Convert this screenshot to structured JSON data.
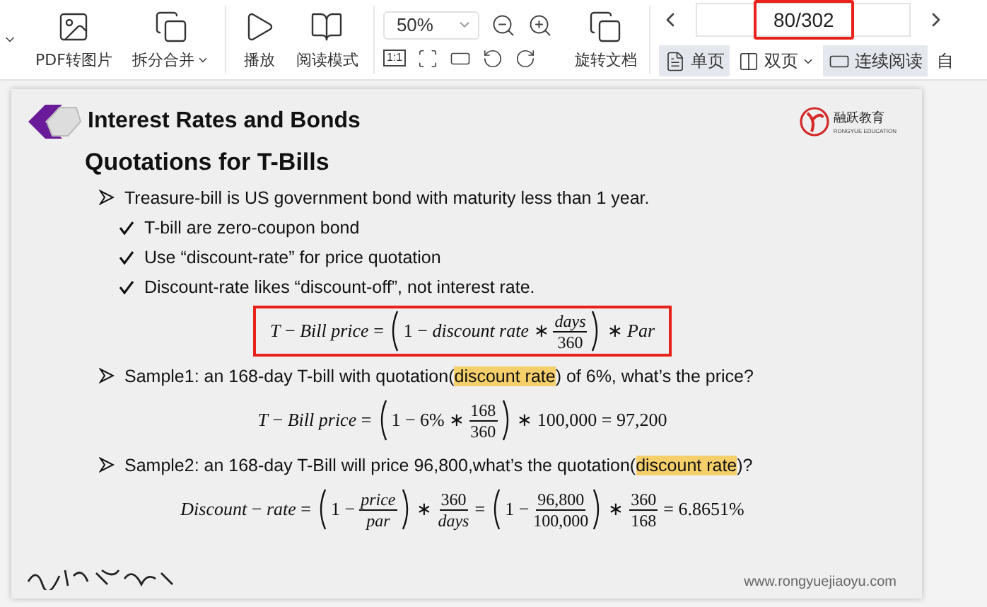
{
  "toolbar": {
    "tools": [
      {
        "kind": "to-image",
        "label": "PDF转图片",
        "has_menu": false
      },
      {
        "kind": "split-merge",
        "label": "拆分合并",
        "has_menu": true
      },
      {
        "kind": "play",
        "label": "播放",
        "has_menu": false
      },
      {
        "kind": "reading",
        "label": "阅读模式",
        "has_menu": false
      }
    ],
    "zoom": {
      "value": "50%",
      "actual_size": "1:1"
    },
    "rotate": {
      "label": "旋转文档"
    },
    "page": {
      "value": "80/302",
      "highlighted": true
    },
    "view_modes": [
      {
        "kind": "single",
        "label": "单页",
        "selected": true,
        "has_menu": false
      },
      {
        "kind": "double",
        "label": "双页",
        "selected": false,
        "has_menu": true
      },
      {
        "kind": "continuous",
        "label": "连续阅读",
        "selected": true,
        "has_menu": false
      },
      {
        "kind": "auto",
        "label": "自",
        "selected": false,
        "has_menu": false
      }
    ]
  },
  "slide": {
    "title": "Interest Rates and Bonds",
    "logo": {
      "name": "融跃教育",
      "tagline": "RONGYUE EDUCATION"
    },
    "subtitle": "Quotations for T-Bills",
    "content": [
      {
        "kind": "bullet",
        "segments": [
          {
            "text": "Treasure-bill is US government bond with maturity less than 1 year.",
            "highlight": false
          }
        ],
        "children": [
          {
            "kind": "check",
            "segments": [
              {
                "text": "T-bill are zero-coupon bond",
                "highlight": false
              }
            ]
          },
          {
            "kind": "check",
            "segments": [
              {
                "text": "Use “discount-rate” for price quotation",
                "highlight": false
              }
            ]
          },
          {
            "kind": "check",
            "segments": [
              {
                "text": "Discount-rate likes “discount-off”, not interest rate.",
                "highlight": false
              }
            ]
          }
        ]
      },
      {
        "kind": "formula",
        "boxed": true,
        "parts": [
          {
            "kind": "text",
            "text": "*T* − *Bill price* ="
          },
          {
            "kind": "group",
            "parts": [
              {
                "kind": "text",
                "text": "1 − *discount rate* ∗"
              },
              {
                "kind": "frac",
                "num": "*days*",
                "den": "360"
              }
            ]
          },
          {
            "kind": "text",
            "text": "∗ *Par*"
          }
        ]
      },
      {
        "kind": "bullet",
        "segments": [
          {
            "text": "Sample1: an 168-day T-bill with quotation(",
            "highlight": false
          },
          {
            "text": "discount rate",
            "highlight": true
          },
          {
            "text": ") of 6%, what’s the price?",
            "highlight": false
          }
        ]
      },
      {
        "kind": "formula",
        "boxed": false,
        "parts": [
          {
            "kind": "text",
            "text": "*T* − *Bill price* ="
          },
          {
            "kind": "group",
            "parts": [
              {
                "kind": "text",
                "text": "1 − 6% ∗"
              },
              {
                "kind": "frac",
                "num": "168",
                "den": "360"
              }
            ]
          },
          {
            "kind": "text",
            "text": "∗ 100,000 = 97,200"
          }
        ]
      },
      {
        "kind": "bullet",
        "segments": [
          {
            "text": "Sample2: an 168-day T-Bill will price 96,800,what’s the quotation(",
            "highlight": false
          },
          {
            "text": "discount rate",
            "highlight": true
          },
          {
            "text": ")?",
            "highlight": false
          }
        ]
      },
      {
        "kind": "formula",
        "boxed": false,
        "parts": [
          {
            "kind": "text",
            "text": "*Discount* − *rate* ="
          },
          {
            "kind": "group",
            "parts": [
              {
                "kind": "text",
                "text": "1 −"
              },
              {
                "kind": "frac",
                "num": "*price*",
                "den": "*par*"
              }
            ]
          },
          {
            "kind": "text",
            "text": "∗"
          },
          {
            "kind": "frac",
            "num": "360",
            "den": "*days*"
          },
          {
            "kind": "text",
            "text": "="
          },
          {
            "kind": "group",
            "parts": [
              {
                "kind": "text",
                "text": "1 −"
              },
              {
                "kind": "frac",
                "num": "96,800",
                "den": "100,000"
              }
            ]
          },
          {
            "kind": "text",
            "text": "∗"
          },
          {
            "kind": "frac",
            "num": "360",
            "den": "168"
          },
          {
            "kind": "text",
            "text": "= 6.8651%"
          }
        ]
      }
    ],
    "website": "www.rongyuejiaoyu.com"
  }
}
